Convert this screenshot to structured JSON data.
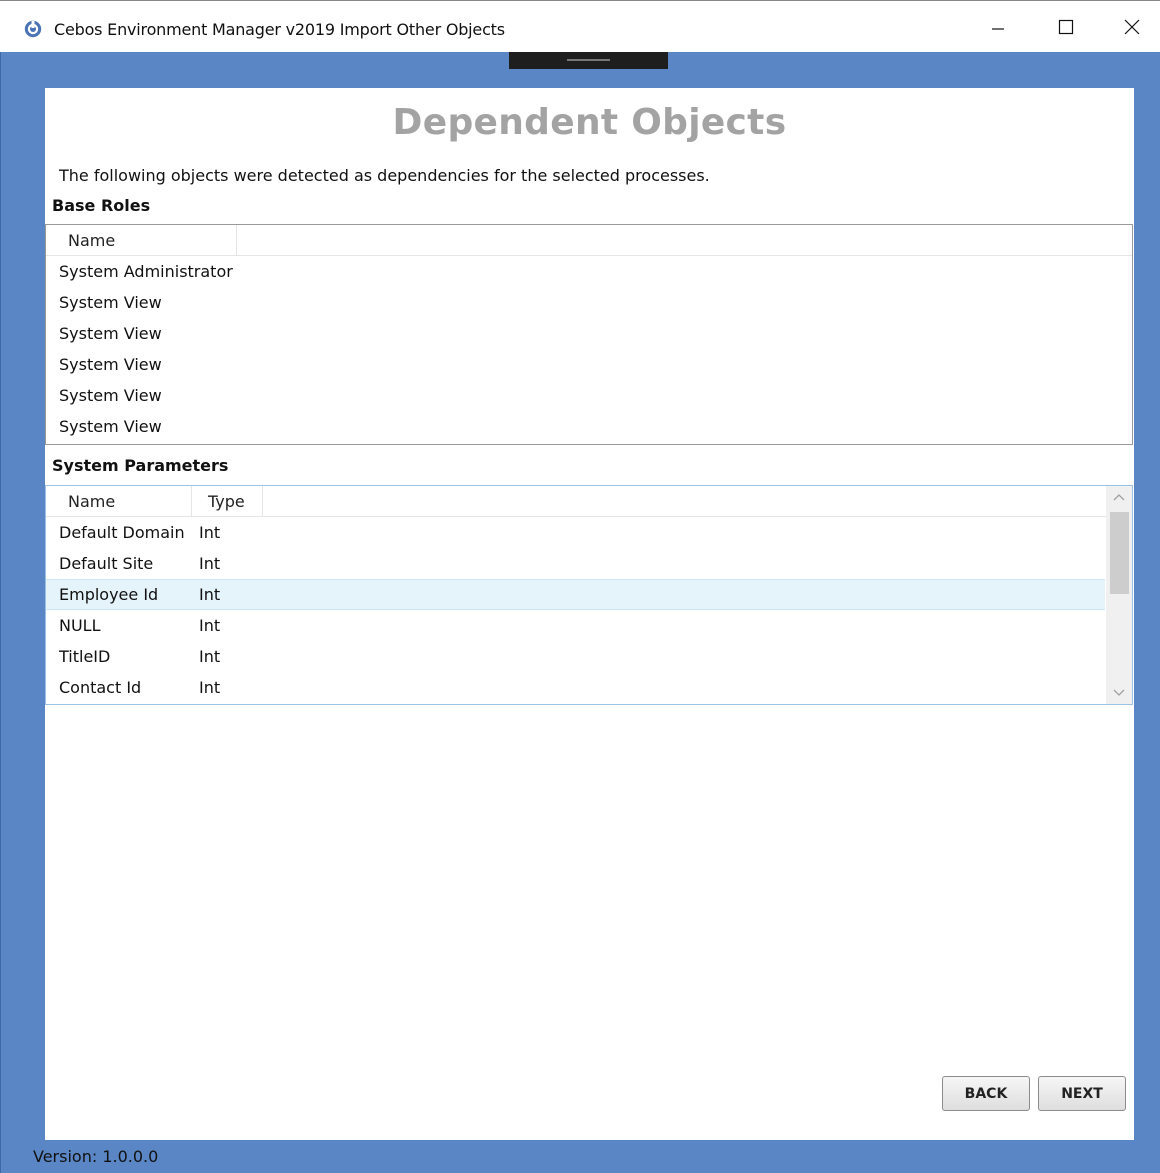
{
  "window": {
    "title": "Cebos Environment Manager v2019 Import Other Objects",
    "icon": "app-logo-icon",
    "controls": [
      "minimize-icon",
      "maximize-icon",
      "close-icon"
    ]
  },
  "page": {
    "heading": "Dependent Objects",
    "description": "The following objects were detected as dependencies for the selected processes."
  },
  "base_roles": {
    "label": "Base Roles",
    "columns": [
      "Name"
    ],
    "rows": [
      "System Administrator",
      "System View",
      "System View",
      "System View",
      "System View",
      "System View"
    ]
  },
  "system_parameters": {
    "label": "System Parameters",
    "columns": [
      "Name",
      "Type"
    ],
    "selected_index": 2,
    "rows": [
      {
        "name": "Default Domain",
        "type": "Int"
      },
      {
        "name": "Default Site",
        "type": "Int"
      },
      {
        "name": "Employee Id",
        "type": "Int"
      },
      {
        "name": "NULL",
        "type": "Int"
      },
      {
        "name": "TitleID",
        "type": "Int"
      },
      {
        "name": "Contact Id",
        "type": "Int"
      }
    ]
  },
  "buttons": {
    "back_label": "BACK",
    "next_label": "NEXT"
  },
  "footer": {
    "version": "Version: 1.0.0.0"
  },
  "colors": {
    "frame": "#5a86c5",
    "heading": "#a3a3a3",
    "selection": "#e5f3fb"
  }
}
